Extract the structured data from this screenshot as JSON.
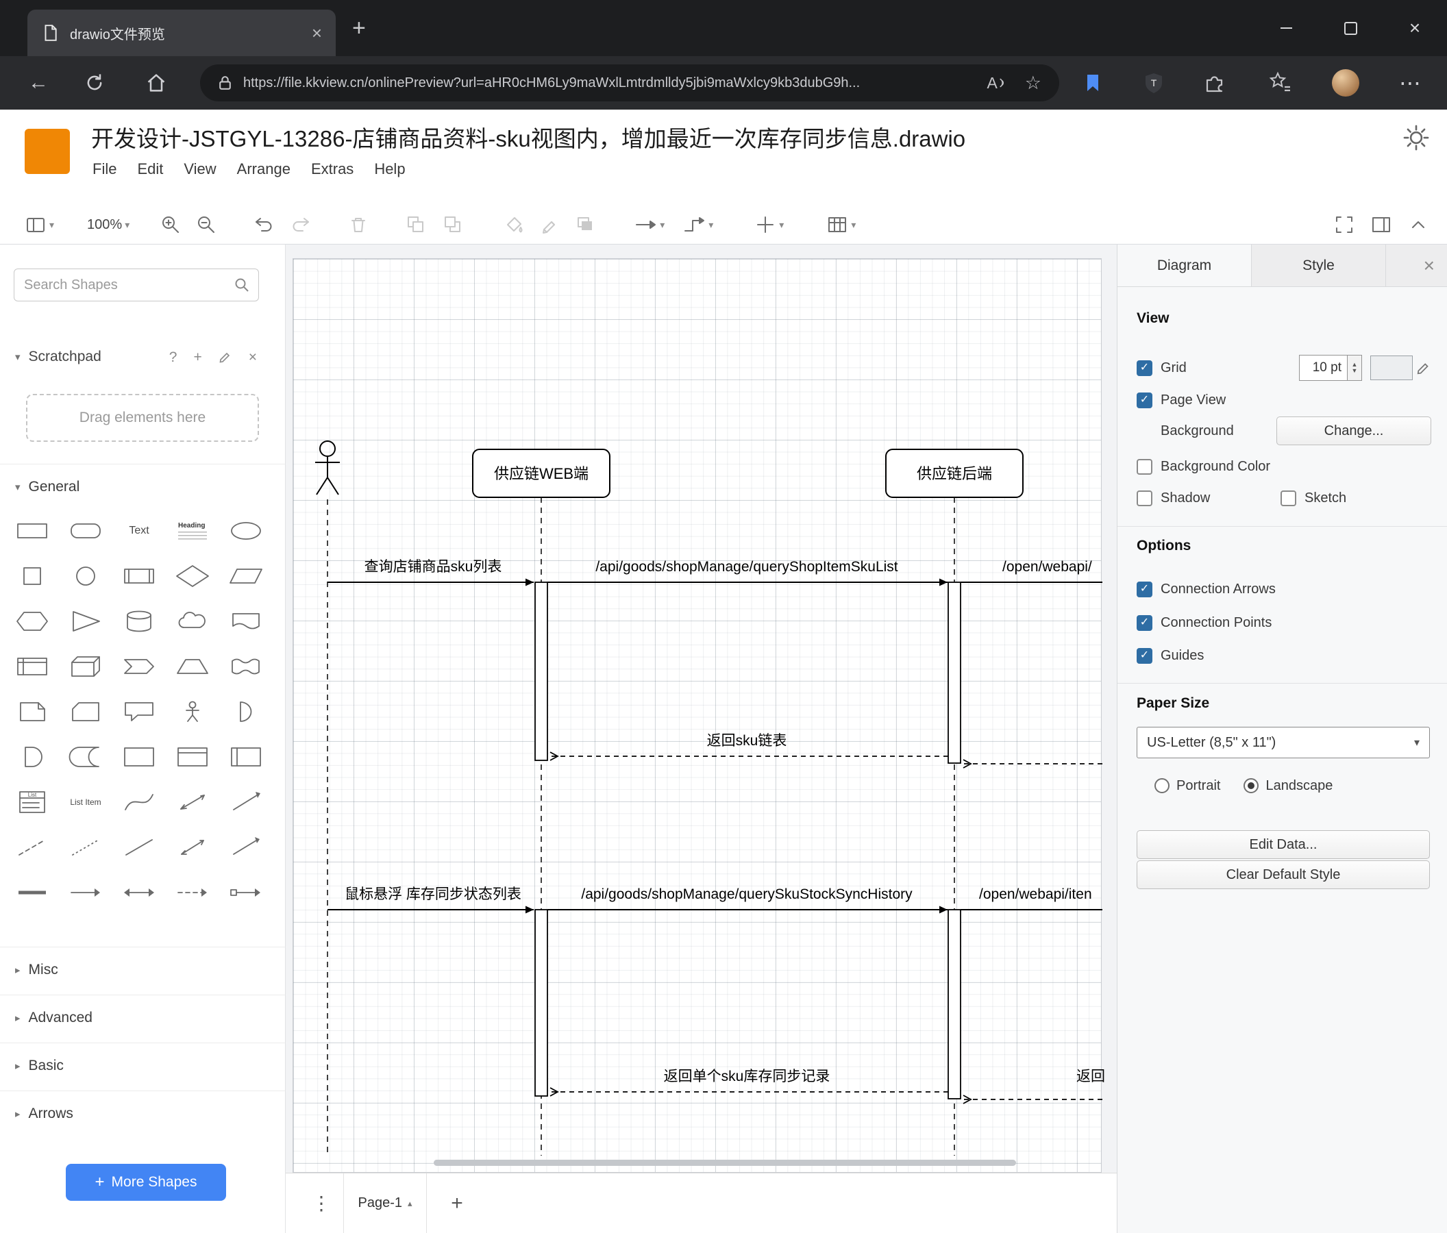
{
  "icons": {
    "caret_down": "▾",
    "caret_right": "▸",
    "caret_up": "▴",
    "close": "×",
    "plus": "+",
    "question": "?",
    "star": "☆",
    "back_arrow": "←",
    "ellipsis_h": "⋯",
    "dots_vertical": "⋮",
    "check": "✓",
    "spinner_up": "▲",
    "spinner_down": "▼",
    "select_arrow": "▾",
    "read_aloud": "A",
    "shield_letter": "T"
  },
  "browser": {
    "tab_title": "drawio文件预览",
    "url": "https://file.kkview.cn/onlinePreview?url=aHR0cHM6Ly9maWxlLmtrdmlldy5jbi9maWxlcy9kb3dubG9h..."
  },
  "app": {
    "doc_title": "开发设计-JSTGYL-13286-店铺商品资料-sku视图内，增加最近一次库存同步信息.drawio",
    "menu": {
      "file": "File",
      "edit": "Edit",
      "view": "View",
      "arrange": "Arrange",
      "extras": "Extras",
      "help": "Help"
    },
    "toolbar": {
      "zoom_level": "100%"
    }
  },
  "shapes_panel": {
    "search_placeholder": "Search Shapes",
    "scratchpad_label": "Scratchpad",
    "scratchpad_hint": "Drag elements here",
    "sections": {
      "general": "General",
      "misc": "Misc",
      "advanced": "Advanced",
      "basic": "Basic",
      "arrows": "Arrows"
    },
    "mini_labels": {
      "text": "Text",
      "heading": "Heading",
      "list": "List",
      "list_item": "List Item"
    },
    "more_shapes_label": "More Shapes"
  },
  "diagram": {
    "lifeline_web": "供应链WEB端",
    "lifeline_backend": "供应链后端",
    "msg_query_sku_list": "查询店铺商品sku列表",
    "api_query_shop_item_sku_list": "/api/goods/shopManage/queryShopItemSkuList",
    "api_open_webapi_1": "/open/webapi/",
    "return_sku_list": "返回sku链表",
    "msg_hover_stock_sync": "鼠标悬浮 库存同步状态列表",
    "api_query_sku_stock_sync_history": "/api/goods/shopManage/querySkuStockSyncHistory",
    "api_open_webapi_2": "/open/webapi/iten",
    "return_single_sku_record": "返回单个sku库存同步记录",
    "return_partial": "返回"
  },
  "format_panel": {
    "tab_diagram": "Diagram",
    "tab_style": "Style",
    "view": {
      "heading": "View",
      "grid_label": "Grid",
      "grid_size": "10 pt",
      "page_view_label": "Page View",
      "background_label": "Background",
      "change_button": "Change...",
      "background_color_label": "Background Color",
      "shadow_label": "Shadow",
      "sketch_label": "Sketch"
    },
    "options": {
      "heading": "Options",
      "connection_arrows_label": "Connection Arrows",
      "connection_points_label": "Connection Points",
      "guides_label": "Guides"
    },
    "paper": {
      "heading": "Paper Size",
      "size_value": "US-Letter (8,5\" x 11\")",
      "portrait_label": "Portrait",
      "landscape_label": "Landscape"
    },
    "edit_data_button": "Edit Data...",
    "clear_default_style_button": "Clear Default Style"
  },
  "footer": {
    "page_tab_label": "Page-1"
  }
}
